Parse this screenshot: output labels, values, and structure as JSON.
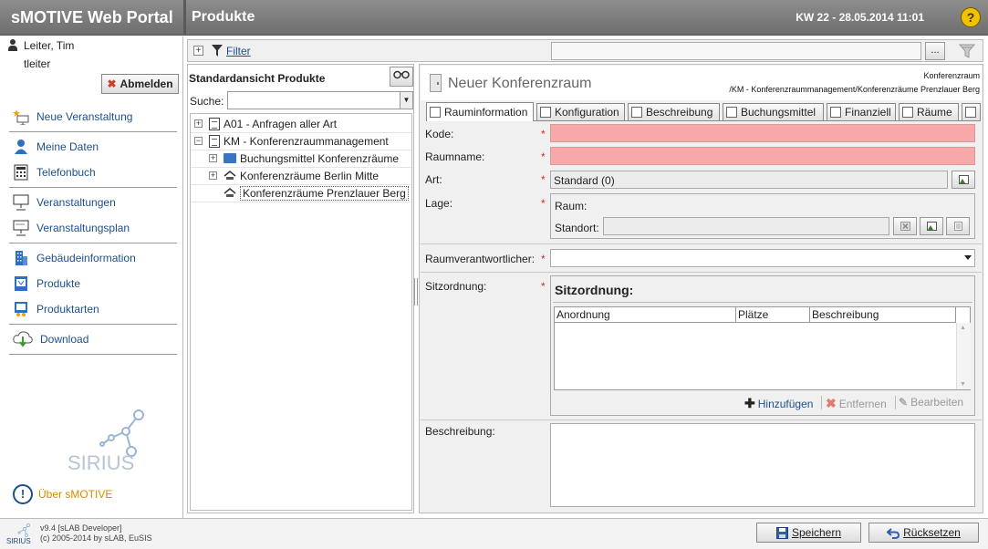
{
  "app": {
    "title": "sMOTIVE Web Portal",
    "page_title": "Produkte",
    "week_date": "KW 22 - 28.05.2014 11:01",
    "help_label": "?"
  },
  "user": {
    "name": "Leiter, Tim",
    "login": "tleiter",
    "logout_label": "Abmelden"
  },
  "nav": {
    "items": [
      {
        "label": "Neue Veranstaltung",
        "icon": "new-event-icon"
      },
      {
        "label": "Meine Daten",
        "icon": "my-data-icon"
      },
      {
        "label": "Telefonbuch",
        "icon": "phonebook-icon"
      },
      {
        "label": "Veranstaltungen",
        "icon": "presentation-icon"
      },
      {
        "label": "Veranstaltungsplan",
        "icon": "schedule-icon"
      },
      {
        "label": "Gebäudeinformation",
        "icon": "building-icon"
      },
      {
        "label": "Produkte",
        "icon": "products-icon"
      },
      {
        "label": "Produktarten",
        "icon": "product-types-icon"
      },
      {
        "label": "Download",
        "icon": "download-icon"
      }
    ],
    "about_label": "Über sMOTIVE"
  },
  "logo_text": "SIRIUS",
  "footer": {
    "version_line1": "v9.4 [sLAB Developer]",
    "version_line2": "(c) 2005-2014 by sLAB, EuSIS",
    "save_label": "Speichern",
    "reset_label": "Rücksetzen"
  },
  "filter": {
    "label": "Filter",
    "more_label": "..."
  },
  "tree": {
    "title": "Standardansicht Produkte",
    "search_label": "Suche:",
    "search_value": "",
    "nodes": [
      {
        "label": "A01 - Anfragen aller Art",
        "toggle": "+"
      },
      {
        "label": "KM - Konferenzraummanagement",
        "toggle": "−"
      },
      {
        "label": "Buchungsmittel Konferenzräume",
        "toggle": "+"
      },
      {
        "label": "Konferenzräume Berlin Mitte",
        "toggle": "+"
      },
      {
        "label": "Konferenzräume Prenzlauer Berg",
        "toggle": ""
      }
    ]
  },
  "record": {
    "title": "Neuer Konferenzraum",
    "type": "Konferenzraum",
    "path": "/KM - Konferenzraummanagement/Konferenzräume Prenzlauer Berg"
  },
  "tabs": [
    {
      "label": "Rauminformation",
      "active": true
    },
    {
      "label": "Konfiguration",
      "active": false
    },
    {
      "label": "Beschreibung",
      "active": false
    },
    {
      "label": "Buchungsmittel",
      "active": false
    },
    {
      "label": "Finanziell",
      "active": false
    },
    {
      "label": "Räume",
      "active": false
    }
  ],
  "form": {
    "required_marker": "*",
    "kode_label": "Kode:",
    "kode_value": "",
    "raumname_label": "Raumname:",
    "raumname_value": "",
    "art_label": "Art:",
    "art_value": "Standard (0)",
    "lage_label": "Lage:",
    "raum_label": "Raum:",
    "standort_label": "Standort:",
    "standort_value": "",
    "verantwortlicher_label": "Raumverantwortlicher:",
    "verantwortlicher_value": "",
    "sitzordnung_label": "Sitzordnung:",
    "sitzordnung_title": "Sitzordnung:",
    "sitz_columns": [
      "Anordnung",
      "Plätze",
      "Beschreibung"
    ],
    "add_label": "Hinzufügen",
    "remove_label": "Entfernen",
    "edit_label": "Bearbeiten",
    "beschreibung_label": "Beschreibung:",
    "beschreibung_value": ""
  },
  "colors": {
    "required_field": "#f7a8a8",
    "link": "#1d4f8c",
    "about": "#d98b00",
    "titlebar": "#7d7d7d"
  }
}
